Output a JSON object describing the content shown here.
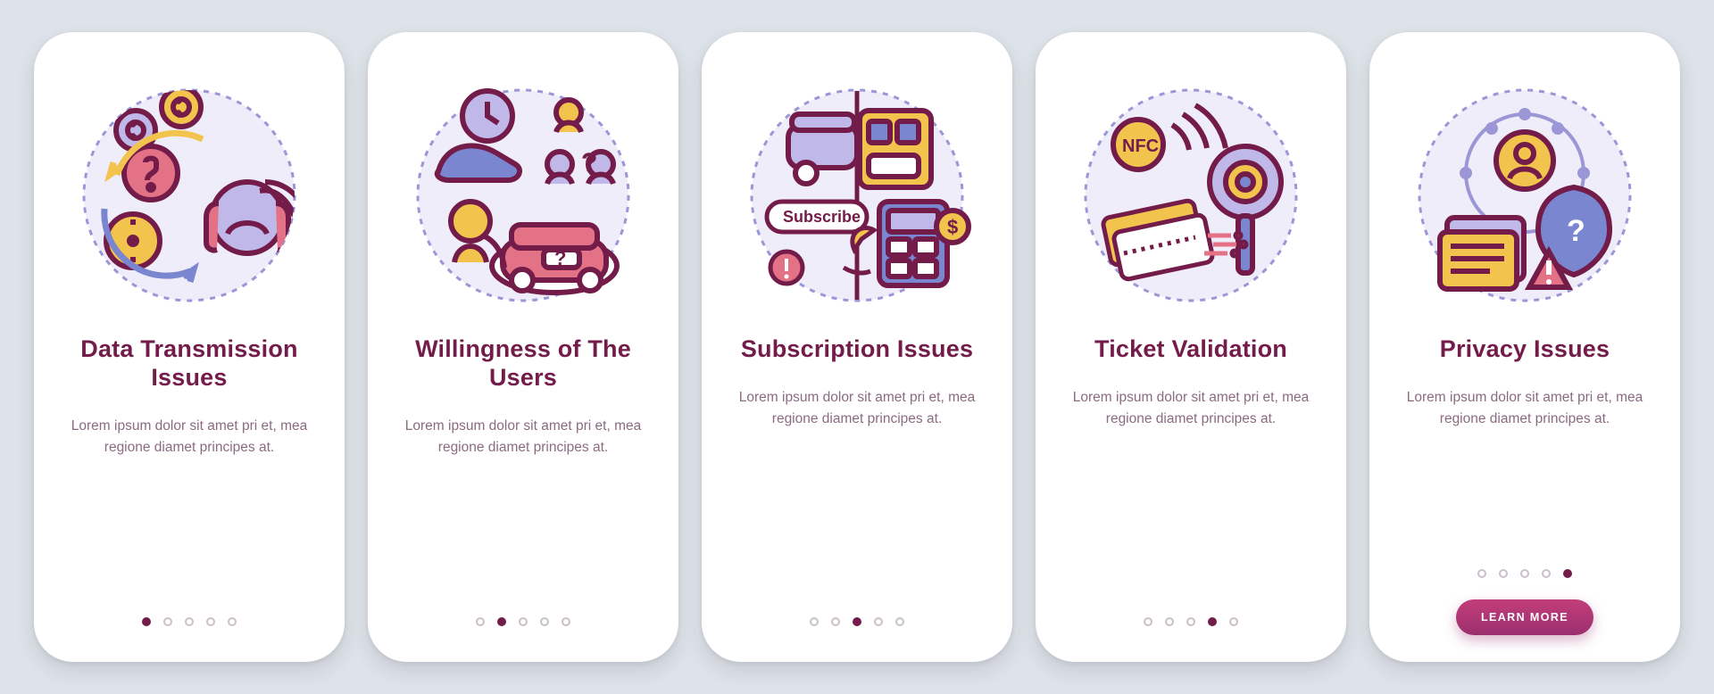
{
  "slides": [
    {
      "title": "Data Transmission Issues",
      "body": "Lorem ipsum dolor sit amet pri et, mea regione diamet principes at."
    },
    {
      "title": "Willingness of The Users",
      "body": "Lorem ipsum dolor sit amet pri et, mea regione diamet principes at."
    },
    {
      "title": "Subscription Issues",
      "body": "Lorem ipsum dolor sit amet pri et, mea regione diamet principes at."
    },
    {
      "title": "Ticket Validation",
      "body": "Lorem ipsum dolor sit amet pri et, mea regione diamet principes at."
    },
    {
      "title": "Privacy Issues",
      "body": "Lorem ipsum dolor sit amet pri et, mea regione diamet principes at."
    }
  ],
  "cta_label": "LEARN MORE",
  "subscribe_label": "Subscribe",
  "nfc_label": "NFC",
  "total_dots": 5,
  "colors": {
    "background": "#DDE3E8",
    "card": "#FFFFFF",
    "text_primary": "#731C4A",
    "text_muted": "#8B6B80",
    "lavender": "#BFB8E8",
    "yellow": "#F3C44D",
    "pink": "#E47286",
    "blue": "#7B86D1"
  }
}
